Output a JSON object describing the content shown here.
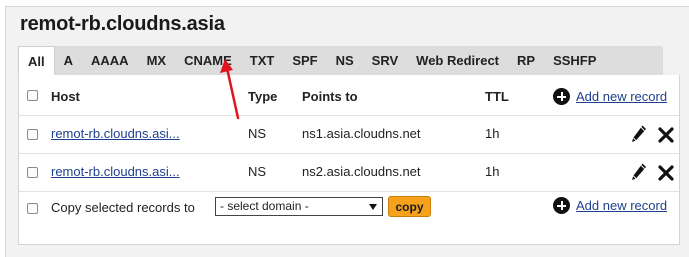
{
  "domain": "remot-rb.cloudns.asia",
  "tabs": [
    {
      "label": "All",
      "active": true
    },
    {
      "label": "A",
      "active": false
    },
    {
      "label": "AAAA",
      "active": false
    },
    {
      "label": "MX",
      "active": false
    },
    {
      "label": "CNAME",
      "active": false
    },
    {
      "label": "TXT",
      "active": false
    },
    {
      "label": "SPF",
      "active": false
    },
    {
      "label": "NS",
      "active": false
    },
    {
      "label": "SRV",
      "active": false
    },
    {
      "label": "Web Redirect",
      "active": false
    },
    {
      "label": "RP",
      "active": false
    },
    {
      "label": "SSHFP",
      "active": false
    }
  ],
  "table": {
    "headers": {
      "host": "Host",
      "type": "Type",
      "points_to": "Points to",
      "ttl": "TTL"
    },
    "add_new_label": "Add new record",
    "rows": [
      {
        "host": "remot-rb.cloudns.asi...",
        "type": "NS",
        "points_to": "ns1.asia.cloudns.net",
        "ttl": "1h"
      },
      {
        "host": "remot-rb.cloudns.asi...",
        "type": "NS",
        "points_to": "ns2.asia.cloudns.net",
        "ttl": "1h"
      }
    ]
  },
  "footer": {
    "copy_label": "Copy selected records to",
    "select_value": "- select domain -",
    "copy_button": "copy",
    "add_new_label": "Add new record"
  },
  "colors": {
    "annotation_arrow": "#e0141e",
    "copy_button": "#f7a21b",
    "link": "#1f3f8f"
  },
  "icons": {
    "edit": "pencil-icon",
    "delete": "close-icon",
    "add": "plus-circle-icon",
    "select": "chevron-down-icon"
  }
}
